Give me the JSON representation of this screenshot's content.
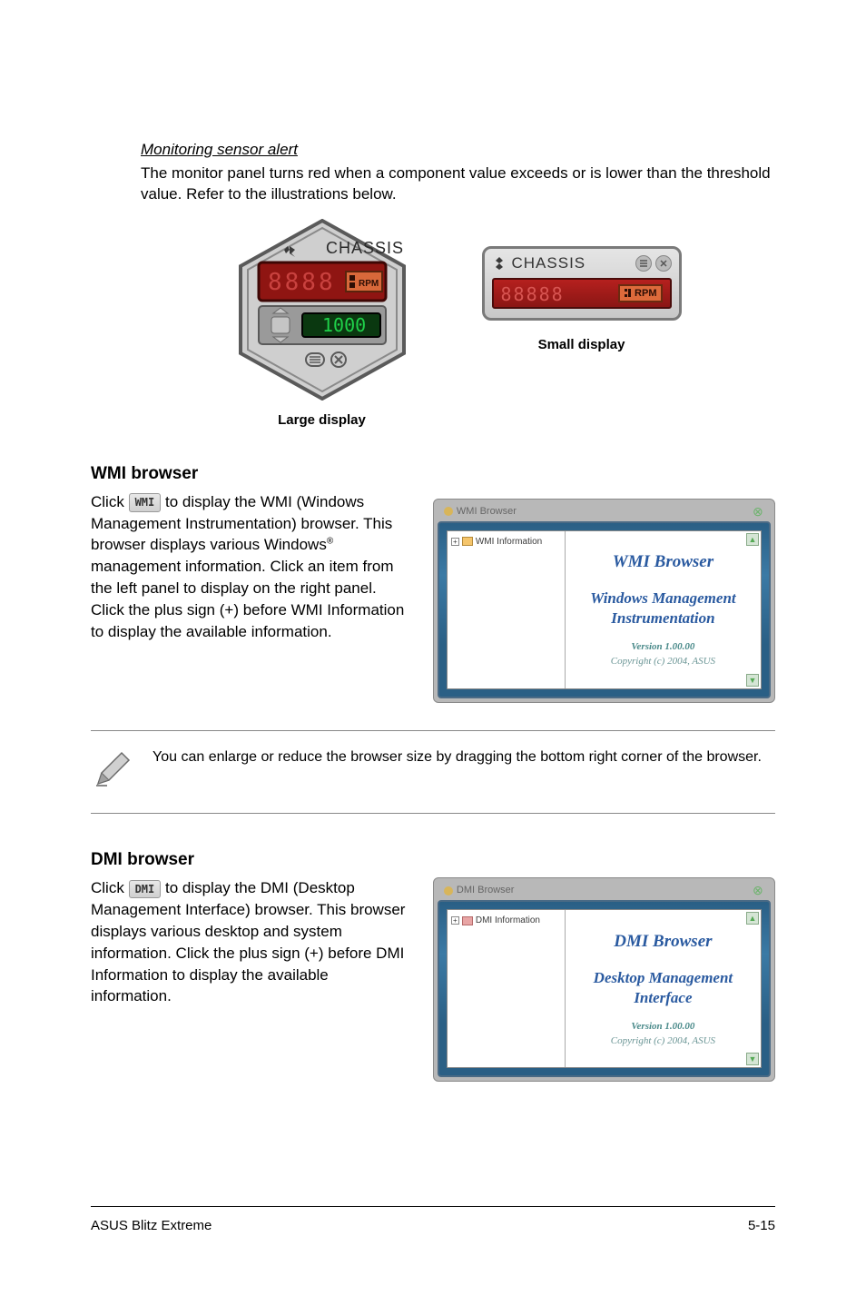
{
  "monitoring": {
    "title": "Monitoring sensor alert",
    "body": "The monitor panel turns red when a component value exceeds or is lower than the threshold value. Refer to the illustrations below."
  },
  "chassis": {
    "label": "CHASSIS",
    "rpm_label": "RPM",
    "large_value": "1000",
    "large_caption": "Large display",
    "small_caption": "Small display"
  },
  "wmi": {
    "heading": "WMI browser",
    "body_prefix": "Click ",
    "btn_label": "WMI",
    "body_suffix": " to display the WMI (Windows Management Instrumentation) browser. This browser displays various Windows",
    "body_suffix2": " management information. Click an item from the left panel to display on the right panel. Click the plus sign (+) before WMI Information to display the available information.",
    "win_title": "WMI Browser",
    "tree_label": "WMI Information",
    "content_title": "WMI Browser",
    "content_sub": "Windows Management Instrumentation",
    "version": "Version 1.00.00",
    "copyright": "Copyright (c) 2004, ASUS"
  },
  "note": {
    "text": "You can enlarge or reduce the browser size by dragging the bottom right corner of the browser."
  },
  "dmi": {
    "heading": "DMI browser",
    "body_prefix": "Click ",
    "btn_label": "DMI",
    "body_suffix": " to display the DMI (Desktop Management Interface) browser. This browser displays various desktop and system information. Click the plus sign (+) before DMI Information to display the available information.",
    "win_title": "DMI Browser",
    "tree_label": "DMI Information",
    "content_title": "DMI Browser",
    "content_sub": "Desktop Management Interface",
    "version": "Version 1.00.00",
    "copyright": "Copyright (c) 2004, ASUS"
  },
  "footer": {
    "left": "ASUS Blitz Extreme",
    "right": "5-15"
  }
}
